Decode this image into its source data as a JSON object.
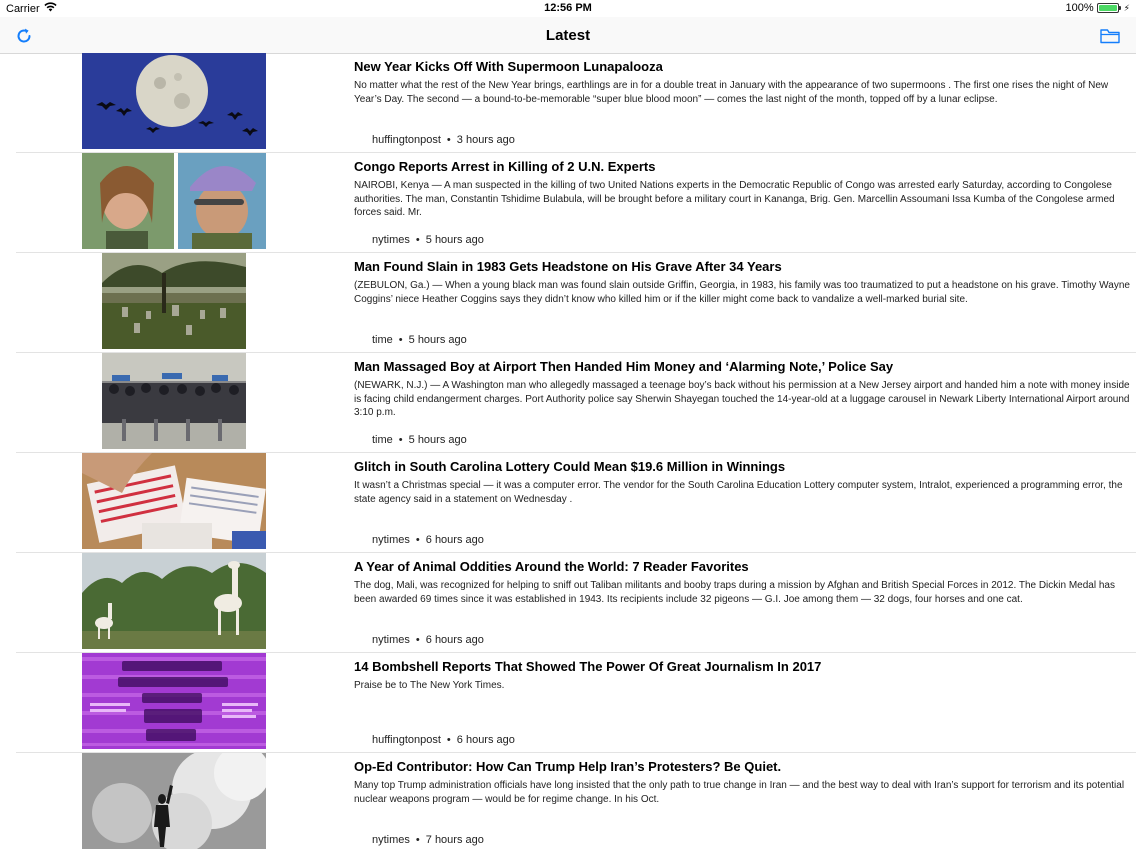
{
  "status": {
    "carrier": "Carrier",
    "time": "12:56 PM",
    "battery": "100%",
    "battery_level": 1.0
  },
  "nav": {
    "title": "Latest",
    "left_icon": "refresh-icon",
    "right_icon": "folder-icon"
  },
  "articles": [
    {
      "title": "New Year Kicks Off With Supermoon Lunapalooza",
      "summary": "No matter what the rest of the New Year brings, earthlings are in for a double treat in January with the appearance of two supermoons . The first one rises the night of New Year’s Day. The second — a bound-to-be-memorable “super blue blood moon” — comes the last night of the month, topped off by a lunar eclipse.",
      "source": "huffingtonpost",
      "time": "3 hours ago",
      "image": "supermoon-with-birds"
    },
    {
      "title": "Congo Reports Arrest in Killing of 2 U.N. Experts",
      "summary": "NAIROBI, Kenya — A man suspected in the killing of two United Nations experts in the Democratic Republic of Congo was arrested early Saturday, according to Congolese authorities. The man, Constantin Tshidime Bulabula, will be brought before a military court in Kananga, Brig. Gen. Marcellin Assoumani Issa Kumba of the Congolese armed forces said. Mr.",
      "source": "nytimes",
      "time": "5 hours ago",
      "image": "two-portraits"
    },
    {
      "title": "Man Found Slain in 1983 Gets Headstone on His Grave After 34 Years",
      "summary": "(ZEBULON, Ga.) — When a young black man was found slain outside Griffin, Georgia, in 1983, his family was too traumatized to put a headstone on his grave. Timothy Wayne Coggins’ niece Heather Coggins says they didn’t know who killed him or if the killer might come back to vandalize a well-marked burial site.",
      "source": "time",
      "time": "5 hours ago",
      "image": "cemetery-under-trees"
    },
    {
      "title": "Man Massaged Boy at Airport Then Handed Him Money and ‘Alarming Note,’ Police Say",
      "summary": "(NEWARK, N.J.) — A Washington man who allegedly massaged a teenage boy’s back without his permission at a New Jersey airport and handed him a note with money inside is facing child endangerment charges. Port Authority police say Sherwin Shayegan touched the 14-year-old at a luggage carousel in Newark Liberty International Airport around 3:10 p.m.",
      "source": "time",
      "time": "5 hours ago",
      "image": "airport-crowd"
    },
    {
      "title": "Glitch in South Carolina Lottery Could Mean $19.6 Million in Winnings",
      "summary": "It wasn’t a Christmas special — it was a computer error. The vendor for the South Carolina Education Lottery computer system, Intralot, experienced a programming error, the state agency said in a statement on Wednesday .",
      "source": "nytimes",
      "time": "6 hours ago",
      "image": "lottery-tickets"
    },
    {
      "title": "A Year of Animal Oddities Around the World: 7 Reader Favorites",
      "summary": "The dog, Mali, was recognized for helping to sniff out Taliban militants and booby traps during a mission by Afghan and British Special Forces in 2012. The Dickin Medal has been awarded 69 times since it was established in 1943. Its recipients include 32 pigeons — G.I. Joe among them — 32 dogs, four horses and one cat.",
      "source": "nytimes",
      "time": "6 hours ago",
      "image": "white-giraffes"
    },
    {
      "title": "14 Bombshell Reports That Showed The Power Of Great Journalism In 2017",
      "summary": "Praise be to The New York Times.",
      "source": "huffingtonpost",
      "time": "6 hours ago",
      "image": "purple-newspaper-mastheads"
    },
    {
      "title": "Op-Ed Contributor: How Can Trump Help Iran’s Protesters? Be Quiet.",
      "summary": "Many top Trump administration officials have long insisted that the only path to true change in Iran — and the best way to deal with Iran’s support for terrorism and its potential nuclear weapons program — would be for regime change. In his Oct.",
      "source": "nytimes",
      "time": "7 hours ago",
      "image": "protester-in-smoke"
    }
  ]
}
